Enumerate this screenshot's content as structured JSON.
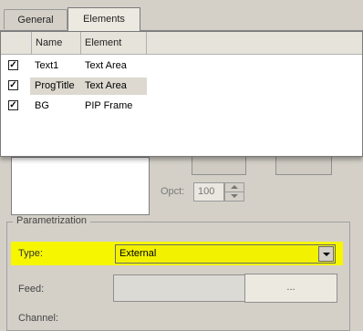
{
  "tabs": [
    {
      "label": "General"
    },
    {
      "label": "Elements"
    }
  ],
  "elements_list": {
    "columns": [
      "Name",
      "Element"
    ],
    "rows": [
      {
        "checked": true,
        "name": "Text1",
        "element": "Text Area"
      },
      {
        "checked": true,
        "name": "ProgTitle",
        "element": "Text Area"
      },
      {
        "checked": true,
        "name": "BG",
        "element": "PIP Frame"
      }
    ]
  },
  "opacity": {
    "label": "Opct:",
    "value": "100"
  },
  "parametrization": {
    "legend": "Parametrization",
    "type_label": "Type:",
    "type_value": "External",
    "feed_label": "Feed:",
    "feed_button": "...",
    "channel_label": "Channel:"
  },
  "colors": {
    "highlight": "#f6f600"
  }
}
